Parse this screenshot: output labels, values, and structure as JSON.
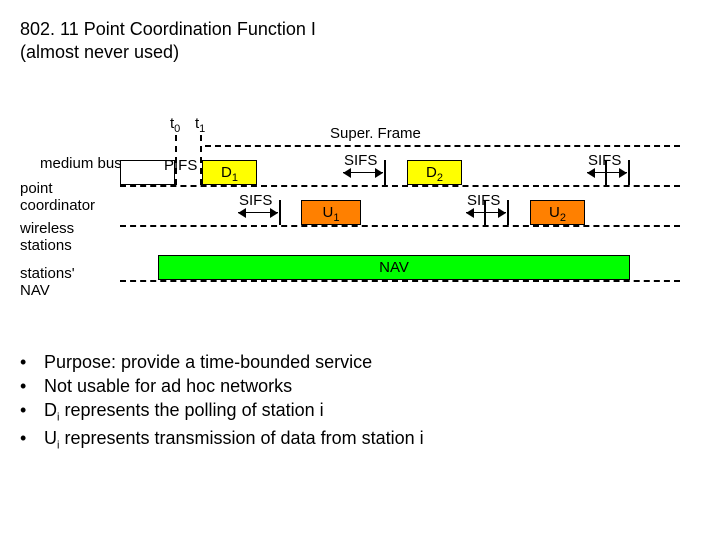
{
  "title_line1": "802. 11 Point Coordination Function I",
  "title_line2": "(almost never used)",
  "t0": "t",
  "t0_sub": "0",
  "t1": "t",
  "t1_sub": "1",
  "superframe": "Super. Frame",
  "medium_busy": "medium busy",
  "point_coordinator": "point\ncoordinator",
  "wireless_stations": "wireless\nstations",
  "stations_nav": "stations'\nNAV",
  "pifs": "PIFS",
  "sifs": "SIFS",
  "d1": "D",
  "d1_sub": "1",
  "d2": "D",
  "d2_sub": "2",
  "u1": "U",
  "u1_sub": "1",
  "u2": "U",
  "u2_sub": "2",
  "nav": "NAV",
  "bullet1": "Purpose: provide a time-bounded service",
  "bullet2": "Not usable for ad hoc networks",
  "bullet3_a": "D",
  "bullet3_b": " represents the polling of station i",
  "bullet4_a": "U",
  "bullet4_b": " represents transmission of data from station i",
  "sub_i": "i",
  "dot": "•"
}
